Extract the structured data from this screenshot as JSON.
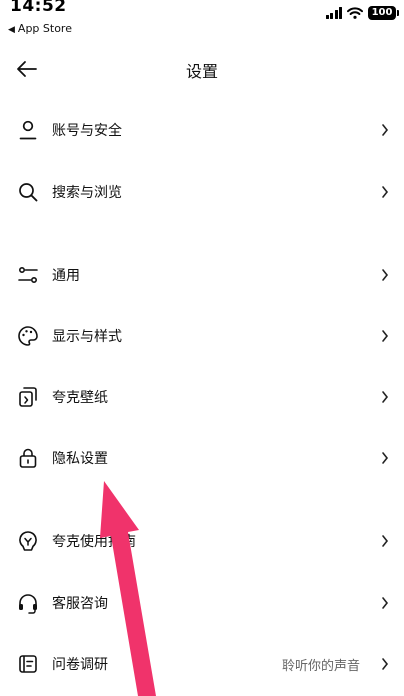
{
  "status_bar": {
    "time": "14:52",
    "back_app": "App Store",
    "battery": "100"
  },
  "nav": {
    "title": "设置",
    "back_icon": "arrow-left-icon"
  },
  "rows": [
    {
      "label": "账号与安全",
      "icon": "user-icon",
      "extra": ""
    },
    {
      "label": "搜索与浏览",
      "icon": "search-icon",
      "extra": ""
    },
    {
      "label": "通用",
      "icon": "sliders-icon",
      "extra": ""
    },
    {
      "label": "显示与样式",
      "icon": "palette-icon",
      "extra": ""
    },
    {
      "label": "夸克壁纸",
      "icon": "wallpaper-icon",
      "extra": ""
    },
    {
      "label": "隐私设置",
      "icon": "lock-icon",
      "extra": ""
    },
    {
      "label": "夸克使用指南",
      "icon": "guide-icon",
      "extra": ""
    },
    {
      "label": "客服咨询",
      "icon": "headset-icon",
      "extra": ""
    },
    {
      "label": "问卷调研",
      "icon": "survey-icon",
      "extra": "聆听你的声音"
    }
  ],
  "annotation": {
    "color": "#f0336b"
  }
}
